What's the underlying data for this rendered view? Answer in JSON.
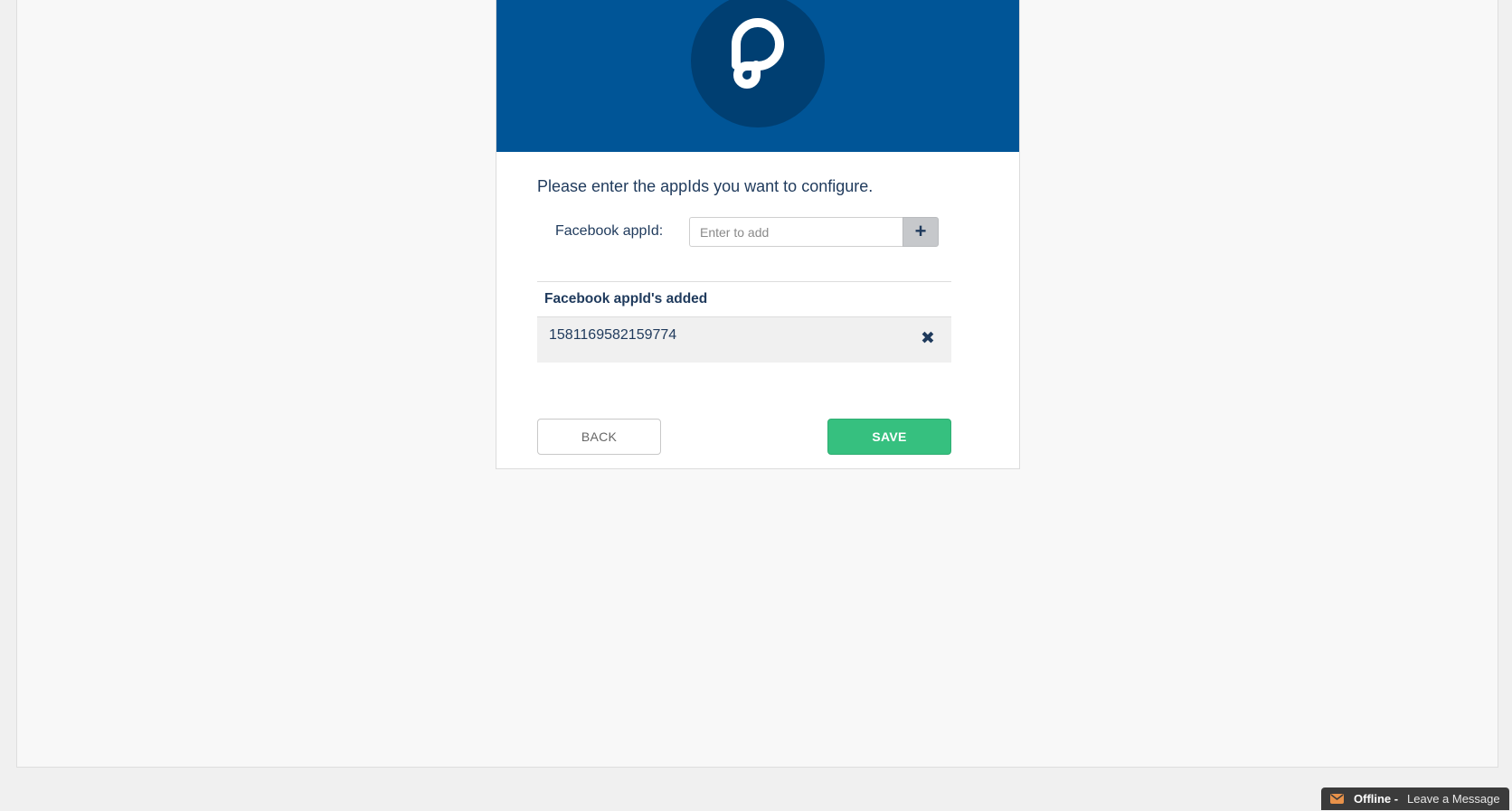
{
  "config": {
    "intro": "Please enter the appIds you want to configure.",
    "field_label": "Facebook appId:",
    "input": {
      "placeholder": "Enter to add",
      "value": ""
    },
    "add_label": "+",
    "list_header": "Facebook appId's added",
    "items": [
      {
        "value": "1581169582159774",
        "remove_label": "✖"
      }
    ],
    "back_label": "BACK",
    "save_label": "SAVE"
  },
  "chat": {
    "status": "Offline -",
    "message": "Leave a Message"
  },
  "colors": {
    "header_blue": "#005597",
    "logo_circle": "#003f72",
    "save_green": "#36c07f",
    "text_navy": "#1f3a5c"
  }
}
